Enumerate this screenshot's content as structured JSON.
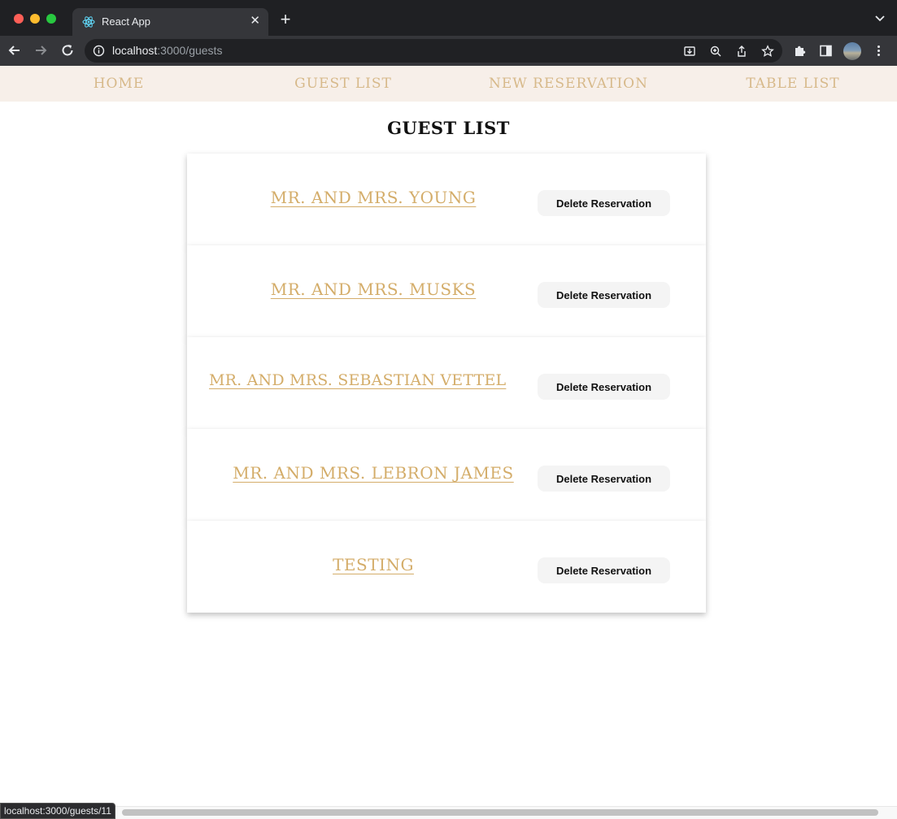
{
  "browser": {
    "tab_title": "React App",
    "url_host": "localhost",
    "url_path": ":3000/guests",
    "status_url": "localhost:3000/guests/11"
  },
  "nav": {
    "links": [
      "HOME",
      "GUEST LIST",
      "NEW RESERVATION",
      "TABLE LIST"
    ]
  },
  "page": {
    "title": "GUEST LIST"
  },
  "guests": [
    {
      "name": "MR. AND MRS. YOUNG",
      "action": "Delete Reservation"
    },
    {
      "name": "MR. AND MRS. MUSKS",
      "action": "Delete Reservation"
    },
    {
      "name": "MR. AND MRS. SEBASTIAN VETTEL",
      "action": "Delete Reservation"
    },
    {
      "name": "MR. AND MRS. LEBRON JAMES",
      "action": "Delete Reservation"
    },
    {
      "name": "TESTING",
      "action": "Delete Reservation"
    }
  ],
  "colors": {
    "nav_bg": "#f7efe9",
    "nav_text": "#d7b98a",
    "guest_link": "#d4ad6a",
    "button_bg": "#f4f4f4"
  }
}
